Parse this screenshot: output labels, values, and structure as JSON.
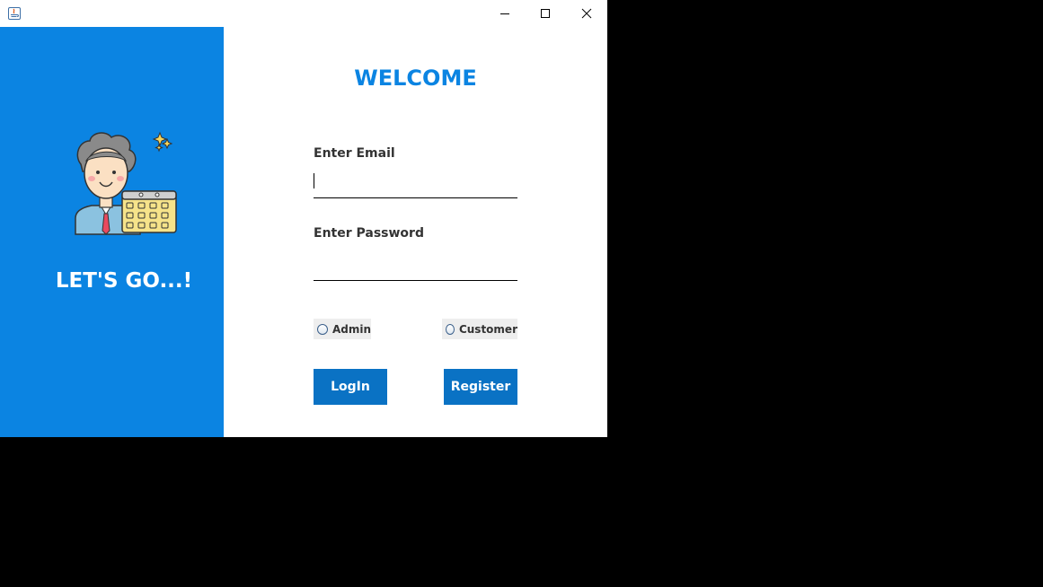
{
  "window": {
    "controls": {
      "minimize_icon": "minimize-icon",
      "maximize_icon": "maximize-icon",
      "close_icon": "close-icon"
    }
  },
  "left_panel": {
    "tagline": "LET'S GO...!",
    "background_color": "#0b84e2"
  },
  "form": {
    "title": "WELCOME",
    "email_label": "Enter Email",
    "email_value": "",
    "password_label": "Enter Password",
    "password_value": "",
    "roles": [
      {
        "label": "Admin",
        "selected": false
      },
      {
        "label": "Customer",
        "selected": false
      }
    ],
    "login_label": "LogIn",
    "register_label": "Register",
    "accent_color": "#0b84e2",
    "button_color": "#0a72c4"
  }
}
